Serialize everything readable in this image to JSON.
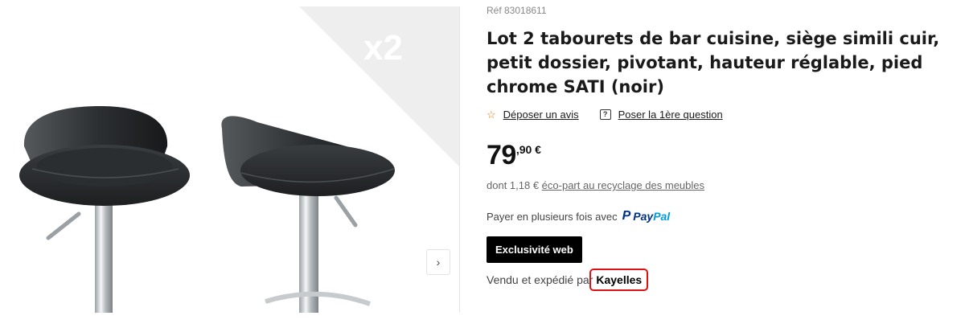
{
  "gallery": {
    "badge_text": "x2",
    "next_label": "›"
  },
  "product": {
    "ref": "Réf 83018611",
    "title": "Lot 2 tabourets de bar cuisine, siège simili cuir, petit dossier, pivotant, hauteur réglable, pied chrome SATI (noir)",
    "review_link": "Déposer un avis",
    "question_link": "Poser la 1ère question",
    "price_integer": "79",
    "price_decimal": ",90 €",
    "eco_prefix": "dont 1,18 € ",
    "eco_link": "éco-part au recyclage des meubles",
    "pay_text": "Payer en plusieurs fois avec",
    "paypal_pay": "Pay",
    "paypal_pal": "Pal",
    "badge": "Exclusivité web",
    "seller_prefix": "Vendu et expédié par",
    "seller_name": "Kayelles"
  },
  "colors": {
    "star": "#e07a00",
    "paypal_dark": "#003087",
    "paypal_light": "#009cde",
    "highlight": "#dd1111"
  }
}
